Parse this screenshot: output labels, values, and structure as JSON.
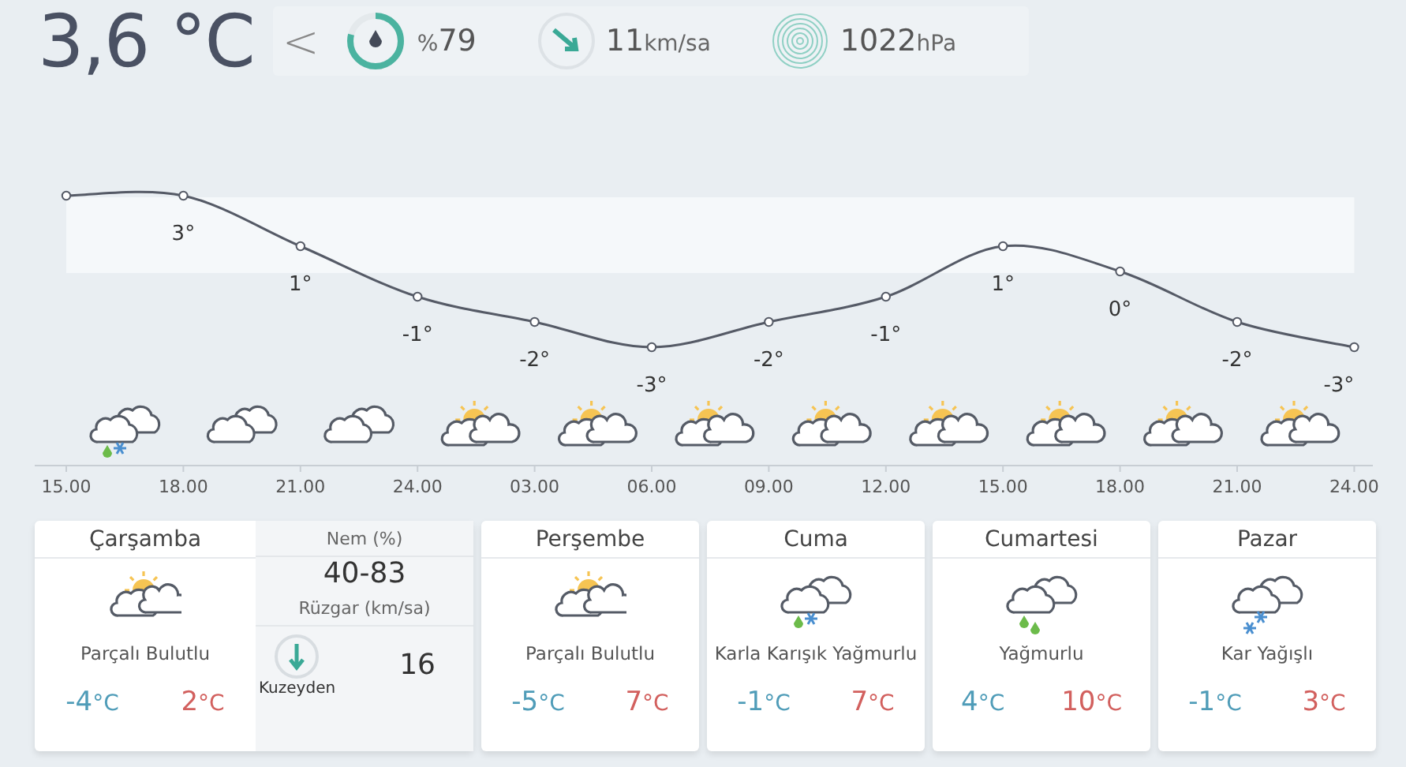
{
  "current": {
    "temperature": "3,6 °C",
    "back": "<",
    "humidity": {
      "prefix": "%",
      "value": "79",
      "level": 0.79
    },
    "wind": {
      "value": "11",
      "unit": "km/sa"
    },
    "pressure": {
      "value": "1022",
      "unit": "hPa"
    }
  },
  "hourly": {
    "chart_data": {
      "type": "line",
      "categories": [
        "15.00",
        "18.00",
        "21.00",
        "24.00",
        "03.00",
        "06.00",
        "09.00",
        "12.00",
        "15.00",
        "18.00",
        "21.00",
        "24.00"
      ],
      "values": [
        3,
        3,
        1,
        -1,
        -2,
        -3,
        -2,
        -1,
        1,
        0,
        -2,
        -3
      ],
      "marker": "circle",
      "bands": [
        {
          "axis": "y",
          "from": 0,
          "to": 3
        }
      ],
      "value_labels": [
        null,
        "3°",
        "1°",
        "-1°",
        "-2°",
        "-3°",
        "-2°",
        "-1°",
        "1°",
        "0°",
        "-2°",
        "-3°"
      ]
    },
    "icons": [
      {
        "kind": "sleet"
      },
      {
        "kind": "cloudy"
      },
      {
        "kind": "cloudy"
      },
      {
        "kind": "partly"
      },
      {
        "kind": "partly"
      },
      {
        "kind": "partly"
      },
      {
        "kind": "partly"
      },
      {
        "kind": "partly"
      },
      {
        "kind": "partly"
      },
      {
        "kind": "partly"
      },
      {
        "kind": "partly"
      }
    ]
  },
  "days": [
    {
      "name": "Çarşamba",
      "kind": "partly",
      "condition": "Parçalı Bulutlu",
      "low": "-4",
      "low_unit": "°C",
      "high": "2",
      "high_unit": "°C",
      "details": {
        "humidity_label": "Nem (%)",
        "humidity": "40-83",
        "wind_label": "Rüzgar (km/sa)",
        "wind_direction": "Kuzeyden",
        "wind": "16"
      }
    },
    {
      "name": "Perşembe",
      "kind": "partly",
      "condition": "Parçalı Bulutlu",
      "low": "-5",
      "low_unit": "°C",
      "high": "7",
      "high_unit": "°C"
    },
    {
      "name": "Cuma",
      "kind": "sleet",
      "condition": "Karla Karışık Yağmurlu",
      "low": "-1",
      "low_unit": "°C",
      "high": "7",
      "high_unit": "°C"
    },
    {
      "name": "Cumartesi",
      "kind": "rain",
      "condition": "Yağmurlu",
      "low": "4",
      "low_unit": "°C",
      "high": "10",
      "high_unit": "°C"
    },
    {
      "name": "Pazar",
      "kind": "snow",
      "condition": "Kar Yağışlı",
      "low": "-1",
      "low_unit": "°C",
      "high": "3",
      "high_unit": "°C"
    }
  ]
}
